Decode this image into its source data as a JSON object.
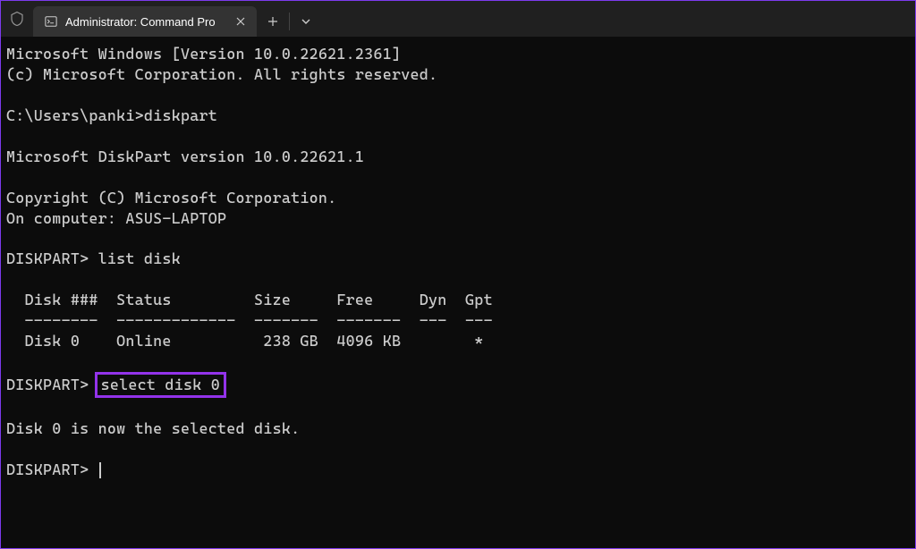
{
  "titlebar": {
    "tab_title": "Administrator: Command Pro"
  },
  "terminal": {
    "line1": "Microsoft Windows [Version 10.0.22621.2361]",
    "line2": "(c) Microsoft Corporation. All rights reserved.",
    "prompt1_path": "C:\\Users\\panki>",
    "prompt1_cmd": "diskpart",
    "dp_version": "Microsoft DiskPart version 10.0.22621.1",
    "dp_copyright": "Copyright (C) Microsoft Corporation.",
    "dp_computer": "On computer: ASUS-LAPTOP",
    "dp_prompt1": "DISKPART> ",
    "dp_cmd1": "list disk",
    "table_header": "  Disk ###  Status         Size     Free     Dyn  Gpt",
    "table_divider": "  --------  -------------  -------  -------  ---  ---",
    "table_row1": "  Disk 0    Online          238 GB  4096 KB        *",
    "dp_prompt2": "DISKPART> ",
    "dp_cmd2_highlighted": "select disk 0",
    "dp_result": "Disk 0 is now the selected disk.",
    "dp_prompt3": "DISKPART> "
  }
}
